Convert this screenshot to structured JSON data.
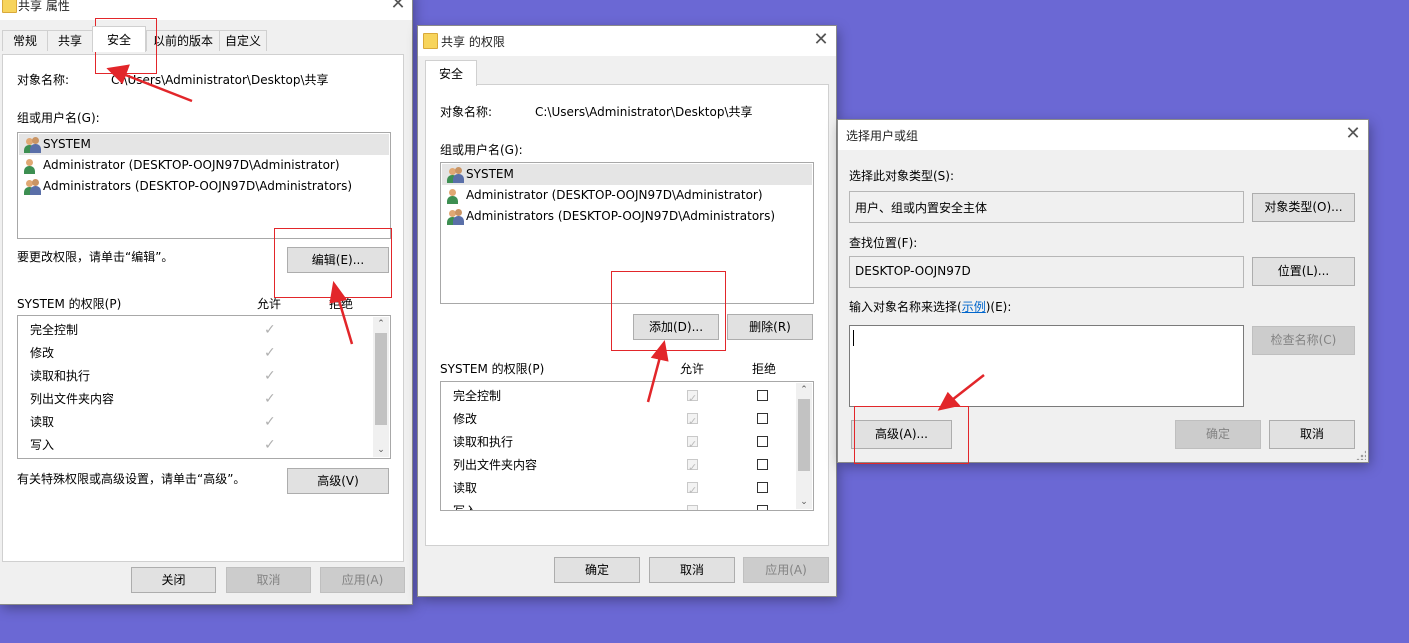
{
  "props_dialog": {
    "title": "共享 属性",
    "tabs": [
      "常规",
      "共享",
      "安全",
      "以前的版本",
      "自定义"
    ],
    "object_label": "对象名称:",
    "object_value": "C:\\Users\\Administrator\\Desktop\\共享",
    "group_label": "组或用户名(G):",
    "users": [
      "SYSTEM",
      "Administrator (DESKTOP-OOJN97D\\Administrator)",
      "Administrators (DESKTOP-OOJN97D\\Administrators)"
    ],
    "edit_hint": "要更改权限，请单击“编辑”。",
    "edit_button": "编辑(E)...",
    "perm_header": "SYSTEM 的权限(P)",
    "allow_header": "允许",
    "deny_header": "拒绝",
    "permissions": [
      "完全控制",
      "修改",
      "读取和执行",
      "列出文件夹内容",
      "读取",
      "写入"
    ],
    "advanced_hint": "有关特殊权限或高级设置，请单击“高级”。",
    "advanced_button": "高级(V)",
    "close_button": "关闭",
    "cancel_button": "取消",
    "apply_button": "应用(A)"
  },
  "perm_dialog": {
    "title": "共享 的权限",
    "tab": "安全",
    "object_label": "对象名称:",
    "object_value": "C:\\Users\\Administrator\\Desktop\\共享",
    "group_label": "组或用户名(G):",
    "users": [
      "SYSTEM",
      "Administrator (DESKTOP-OOJN97D\\Administrator)",
      "Administrators (DESKTOP-OOJN97D\\Administrators)"
    ],
    "add_button": "添加(D)...",
    "remove_button": "删除(R)",
    "perm_header": "SYSTEM 的权限(P)",
    "allow_header": "允许",
    "deny_header": "拒绝",
    "permissions": [
      "完全控制",
      "修改",
      "读取和执行",
      "列出文件夹内容",
      "读取",
      "写入"
    ],
    "ok_button": "确定",
    "cancel_button": "取消",
    "apply_button": "应用(A)"
  },
  "select_dialog": {
    "title": "选择用户或组",
    "type_label": "选择此对象类型(S):",
    "type_value": "用户、组或内置安全主体",
    "type_button": "对象类型(O)...",
    "location_label": "查找位置(F):",
    "location_value": "DESKTOP-OOJN97D",
    "location_button": "位置(L)...",
    "name_label_pre": "输入对象名称来选择(",
    "name_label_link": "示例",
    "name_label_post": ")(E):",
    "check_button": "检查名称(C)",
    "advanced_button": "高级(A)...",
    "ok_button": "确定",
    "cancel_button": "取消"
  },
  "icons": {
    "close": "close-icon",
    "folder": "folder-icon",
    "user": "user-icon",
    "group": "group-icon",
    "check": "checkmark-icon"
  },
  "colors": {
    "background": "#6b68d4",
    "annotation": "#e2262a",
    "link": "#0066cc"
  }
}
